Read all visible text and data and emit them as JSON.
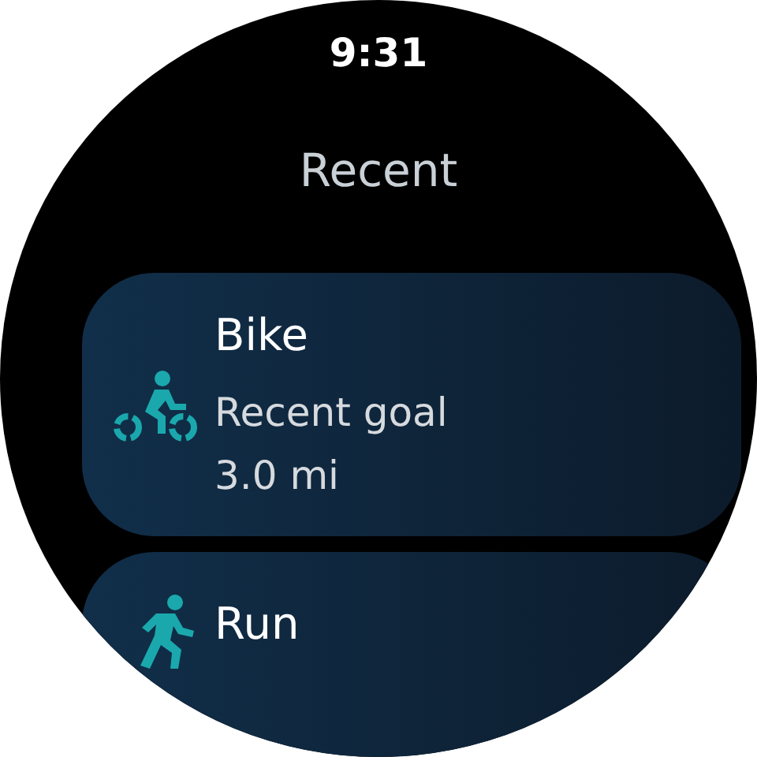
{
  "status_bar": {
    "time": "9:31"
  },
  "title": "Recent",
  "activities": [
    {
      "kind": "bike",
      "name": "Bike",
      "lines": [
        "Recent goal",
        "3.0 mi"
      ]
    },
    {
      "kind": "run",
      "name": "Run"
    }
  ]
}
